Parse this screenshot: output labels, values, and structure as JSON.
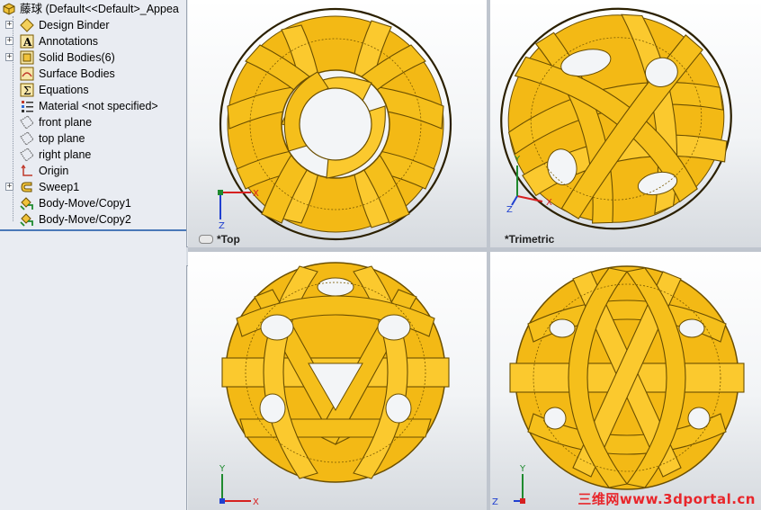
{
  "tree": {
    "root": "藤球  (Default<<Default>_Appea",
    "items": [
      {
        "label": "Design Binder",
        "expand": "+",
        "icon": "design-binder-icon"
      },
      {
        "label": "Annotations",
        "expand": "+",
        "icon": "annotations-icon"
      },
      {
        "label": "Solid Bodies(6)",
        "expand": "+",
        "icon": "solid-bodies-icon"
      },
      {
        "label": "Surface Bodies",
        "expand": "",
        "icon": "surface-bodies-icon"
      },
      {
        "label": "Equations",
        "expand": "",
        "icon": "equations-icon"
      },
      {
        "label": "Material <not specified>",
        "expand": "",
        "icon": "material-icon"
      },
      {
        "label": "front plane",
        "expand": "",
        "icon": "plane-icon"
      },
      {
        "label": "top plane",
        "expand": "",
        "icon": "plane-icon"
      },
      {
        "label": "right plane",
        "expand": "",
        "icon": "plane-icon"
      },
      {
        "label": "Origin",
        "expand": "",
        "icon": "origin-icon"
      },
      {
        "label": "Sweep1",
        "expand": "+",
        "icon": "sweep-icon"
      },
      {
        "label": "Body-Move/Copy1",
        "expand": "",
        "icon": "body-move-icon"
      },
      {
        "label": "Body-Move/Copy2",
        "expand": "",
        "icon": "body-move-icon"
      }
    ]
  },
  "viewports": {
    "top": {
      "label": "*Top",
      "axes": [
        "X",
        "Z"
      ]
    },
    "trimetric": {
      "label": "*Trimetric",
      "axes": [
        "X",
        "Y",
        "Z"
      ]
    },
    "front": {
      "label": "",
      "axes": [
        "X",
        "Y"
      ]
    },
    "right": {
      "label": "",
      "axes": [
        "Z",
        "Y"
      ]
    }
  },
  "watermark": "三维网www.3dportal.cn",
  "colors": {
    "ball": "#f5bf1b",
    "ball_edge": "#6b4f00",
    "selection_line": "#4a78b8"
  }
}
